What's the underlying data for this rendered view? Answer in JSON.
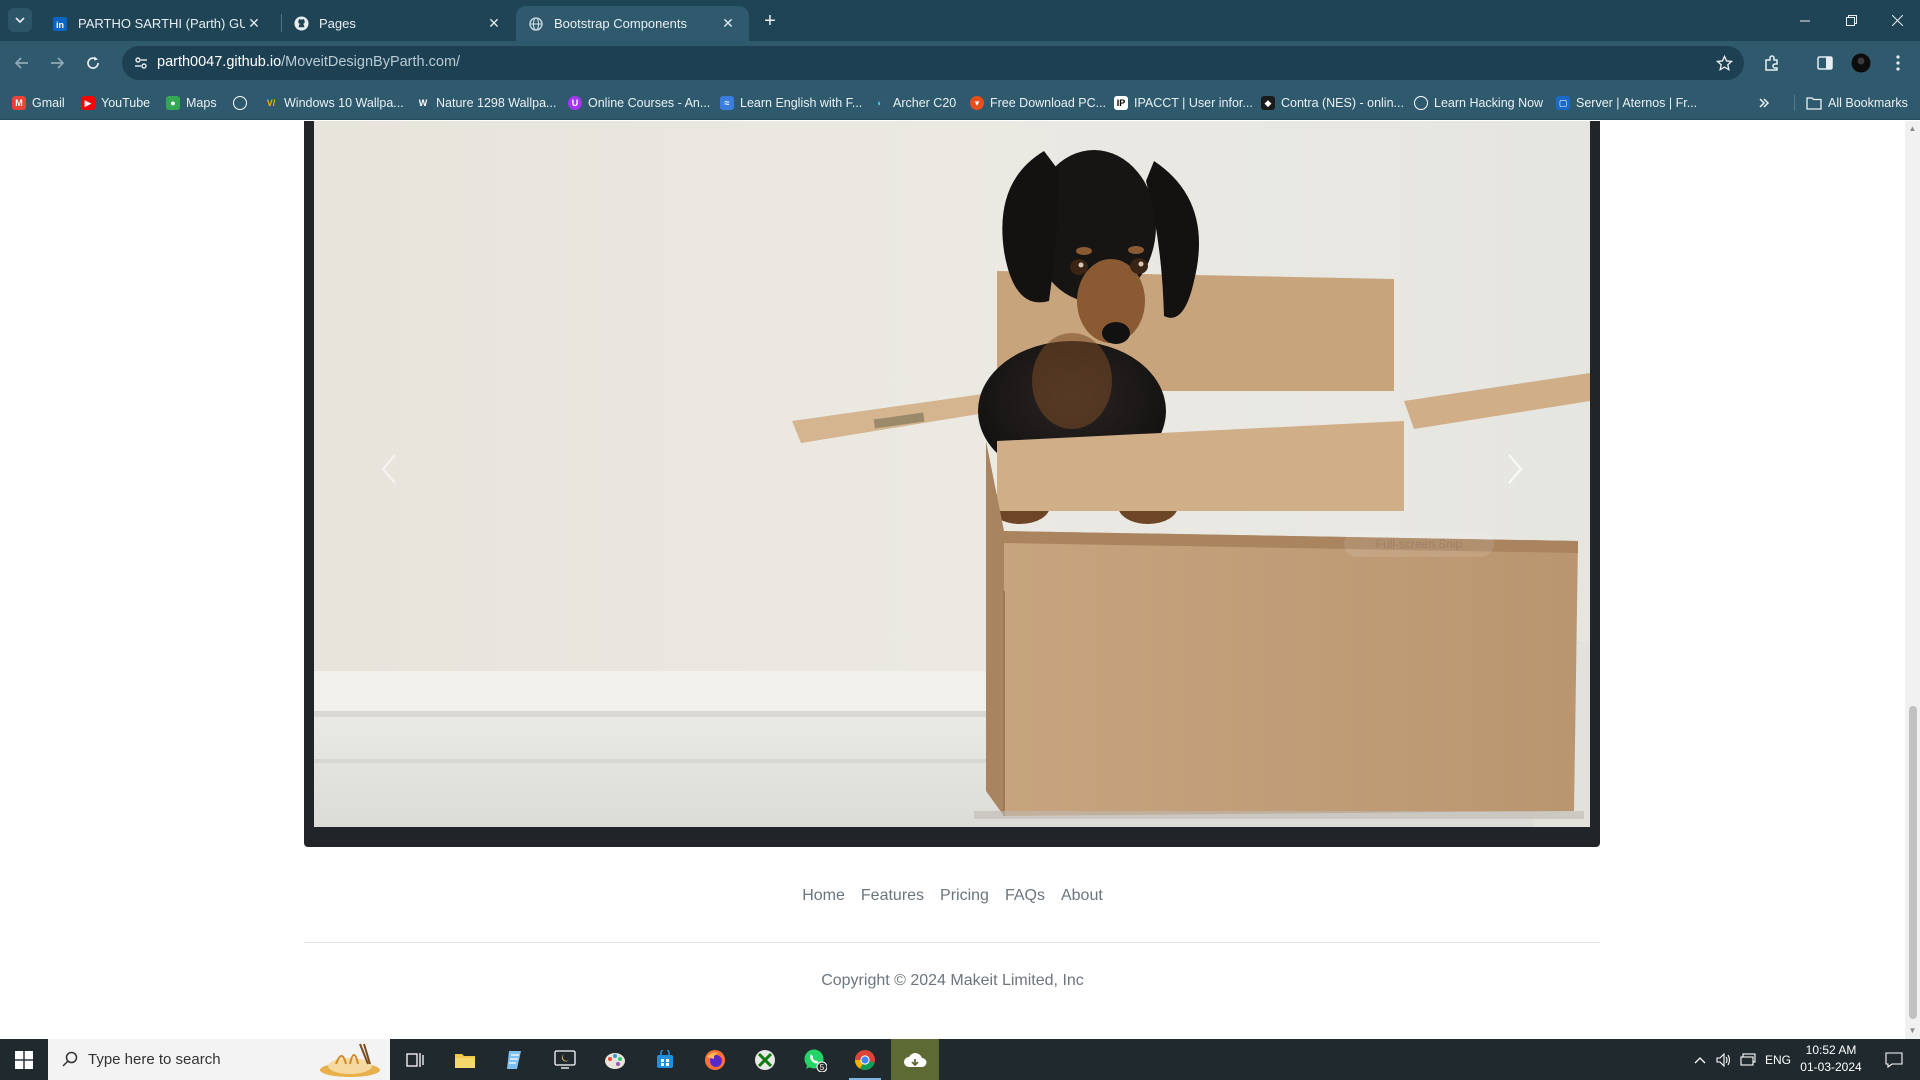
{
  "browser": {
    "tabs": [
      {
        "title": "PARTHO SARTHI (Parth) GUIN |",
        "icon": "linkedin-icon",
        "active": false
      },
      {
        "title": "Pages",
        "icon": "github-icon",
        "active": false
      },
      {
        "title": "Bootstrap Components",
        "icon": "globe-icon",
        "active": true
      }
    ],
    "url_host": "parth0047.github.io",
    "url_path": "/MoveitDesignByParth.com/",
    "bookmarks": [
      {
        "label": "Gmail",
        "icon": "gmail-icon",
        "color": "#ea4335"
      },
      {
        "label": "YouTube",
        "icon": "youtube-icon",
        "color": "#ff0000"
      },
      {
        "label": "Maps",
        "icon": "maps-icon",
        "color": "#34a853"
      },
      {
        "label": "",
        "icon": "globe-icon",
        "color": "#ffffff"
      },
      {
        "label": "Windows 10 Wallpa...",
        "icon": "v-icon",
        "color": "#f5b400"
      },
      {
        "label": "Nature 1298 Wallpa...",
        "icon": "w-icon",
        "color": "#ffffff"
      },
      {
        "label": "Online Courses - An...",
        "icon": "udemy-icon",
        "color": "#a435f0"
      },
      {
        "label": "Learn English with F...",
        "icon": "english-icon",
        "color": "#3b7ddd"
      },
      {
        "label": "Archer C20",
        "icon": "tplink-icon",
        "color": "#4acbd6"
      },
      {
        "label": "Free Download PC...",
        "icon": "download-icon",
        "color": "#e94e1b"
      },
      {
        "label": "IPACCT | User infor...",
        "icon": "ip-icon",
        "color": "#ffffff"
      },
      {
        "label": "Contra (NES) - onlin...",
        "icon": "game-icon",
        "color": "#1b1b1b"
      },
      {
        "label": "Learn Hacking Now",
        "icon": "globe-icon",
        "color": "#ffffff"
      },
      {
        "label": "Server | Aternos | Fr...",
        "icon": "aternos-icon",
        "color": "#1b6ac9"
      }
    ],
    "all_bookmarks": "All Bookmarks"
  },
  "page": {
    "carousel": {
      "image_alt": "Dachshund puppy in a cardboard box",
      "prev_label": "Previous",
      "next_label": "Next",
      "overlay_text": "Full-screen Snip"
    },
    "footer": {
      "nav": [
        "Home",
        "Features",
        "Pricing",
        "FAQs",
        "About"
      ],
      "copyright": "Copyright © 2024 Makeit Limited, Inc"
    }
  },
  "taskbar": {
    "search_placeholder": "Type here to search",
    "apps": [
      "task-view-icon",
      "file-explorer-icon",
      "notepad-icon",
      "terminal-icon",
      "paint-icon",
      "store-icon",
      "firefox-icon",
      "xbox-icon",
      "whatsapp-icon",
      "chrome-icon",
      "cloud-icon"
    ],
    "whatsapp_badge": "5",
    "language": "ENG",
    "time": "10:52 AM",
    "date": "01-03-2024"
  },
  "colors": {
    "frame": "#2f5a6e",
    "tabstrip": "#1f4456",
    "carousel_border": "#212529",
    "footer_text": "#6c757d"
  }
}
